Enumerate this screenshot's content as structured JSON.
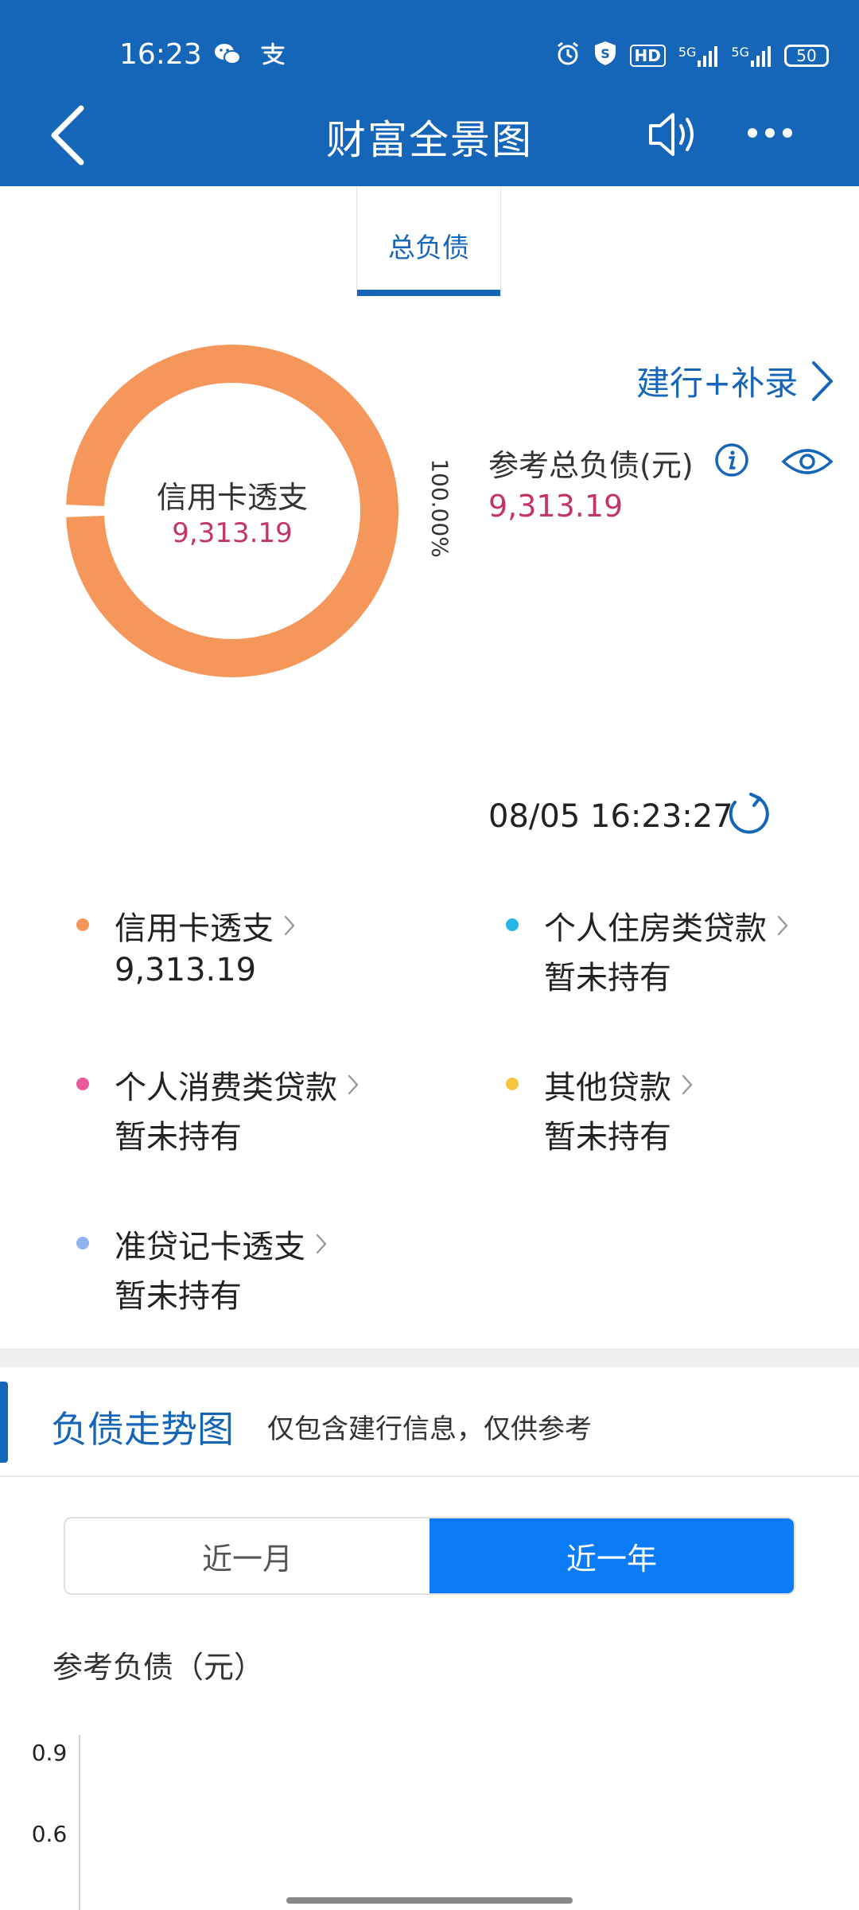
{
  "status_bar": {
    "time": "16:23",
    "app_icons": [
      "wechat-icon",
      "alipay-icon"
    ],
    "right_labels": {
      "hd": "HD",
      "network1": "5G",
      "network2": "5G",
      "battery": "50"
    }
  },
  "header": {
    "title": "财富全景图"
  },
  "tabs": [
    {
      "label": "总负债",
      "active": true
    }
  ],
  "summary": {
    "donut": {
      "center_label": "信用卡透支",
      "center_value": "9,313.19",
      "percent_label": "100.00%",
      "color": "#f5975a",
      "fraction": 1.0
    },
    "link_label": "建行+补录",
    "total_label": "参考总负债(元)",
    "total_value": "9,313.19",
    "timestamp": "08/05 16:23:27"
  },
  "categories": [
    {
      "name": "信用卡透支",
      "value": "9,313.19",
      "color": "#f5975a"
    },
    {
      "name": "个人住房类贷款",
      "value": "暂未持有",
      "color": "#27b5e6"
    },
    {
      "name": "个人消费类贷款",
      "value": "暂未持有",
      "color": "#ea5b9a"
    },
    {
      "name": "其他贷款",
      "value": "暂未持有",
      "color": "#f5c542"
    },
    {
      "name": "准贷记卡透支",
      "value": "暂未持有",
      "color": "#8fb4f0"
    }
  ],
  "trend": {
    "title": "负债走势图",
    "note": "仅包含建行信息，仅供参考",
    "periods": [
      {
        "label": "近一月",
        "active": false
      },
      {
        "label": "近一年",
        "active": true
      }
    ],
    "y_title": "参考负债（元）"
  },
  "chart_data": {
    "type": "line",
    "ylabel": "参考负债（元）",
    "y_ticks": [
      "0.9",
      "0.6"
    ],
    "series": []
  }
}
